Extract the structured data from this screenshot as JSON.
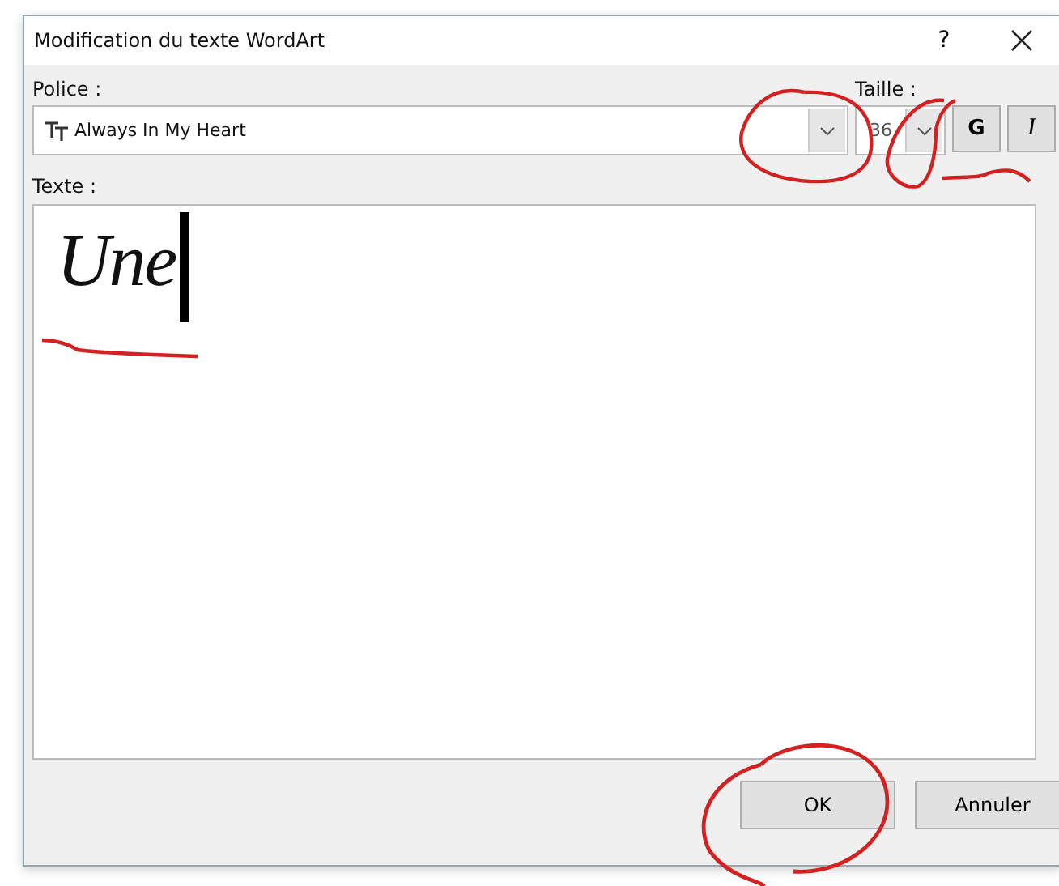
{
  "window": {
    "title": "Modification du texte WordArt",
    "help": "?"
  },
  "font": {
    "label": "Police :",
    "value": "Always In My Heart"
  },
  "size": {
    "label": "Taille :",
    "value": "36"
  },
  "style_buttons": [
    {
      "label": "G",
      "kind": "bold"
    },
    {
      "label": "I",
      "kind": "italic"
    }
  ],
  "text": {
    "label": "Texte :",
    "value": "Une"
  },
  "buttons": [
    "OK",
    "Annuler"
  ]
}
